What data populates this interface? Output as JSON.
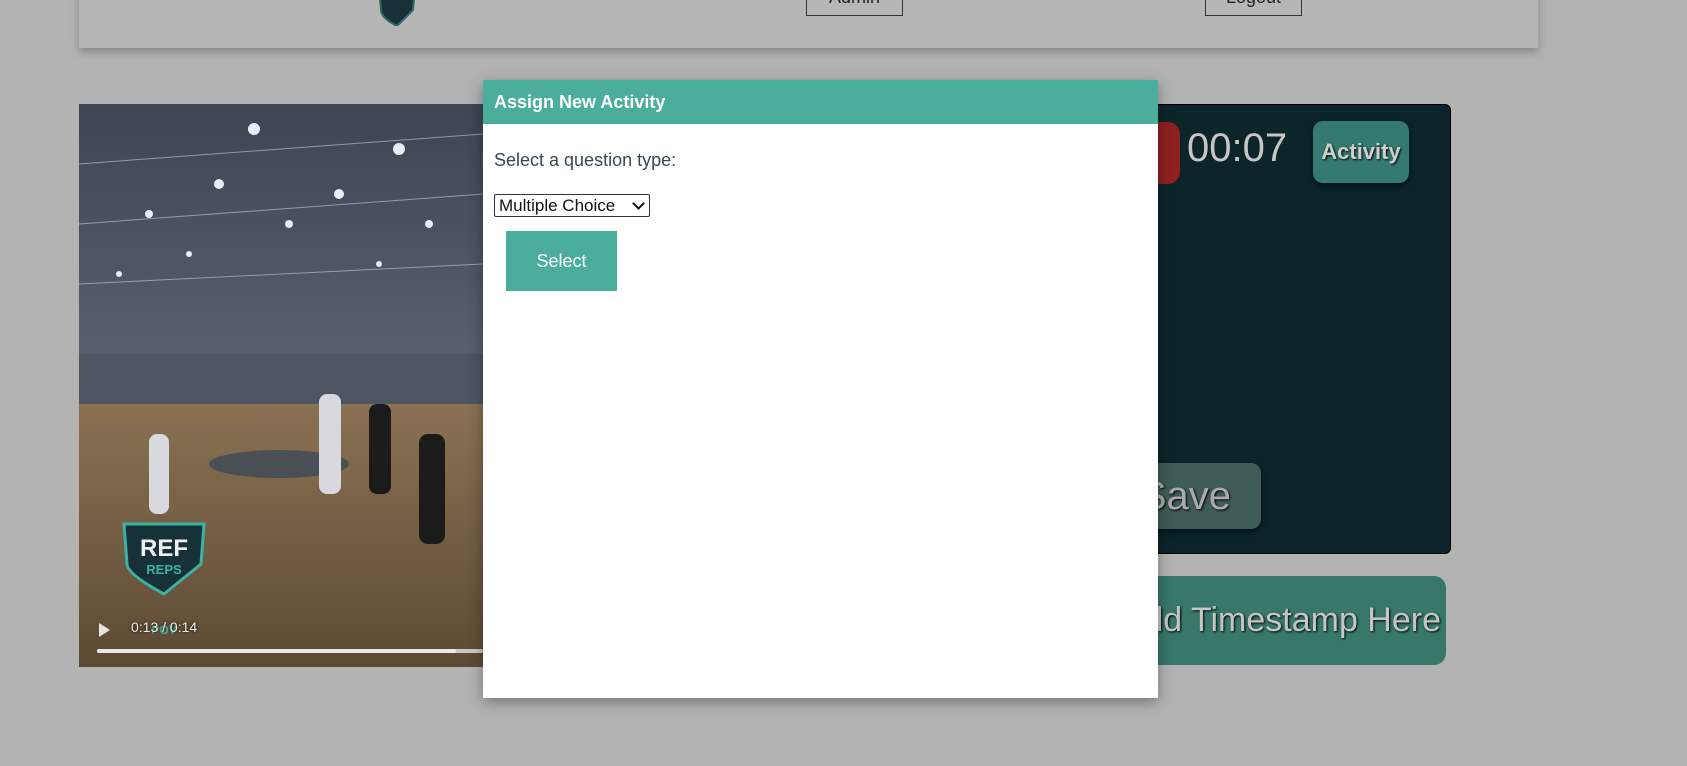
{
  "header": {
    "admin_label": "Admin",
    "logout_label": "Logout"
  },
  "video": {
    "time_display": "0:13 / 0:14",
    "progress": 0.93,
    "watermark_line1": "REF",
    "watermark_line2": "REPS",
    "watermark_line3": "POV"
  },
  "panel": {
    "timer": "00:07",
    "activity_label": "Activity",
    "save_label": "Save",
    "add_timestamp_label": "Add Timestamp Here"
  },
  "modal": {
    "title": "Assign New Activity",
    "prompt": "Select a question type:",
    "selected_type": "Multiple Choice",
    "select_button": "Select"
  },
  "colors": {
    "accent": "#4aae9b",
    "panel_bg": "#0b2529",
    "record": "#8e2020"
  }
}
